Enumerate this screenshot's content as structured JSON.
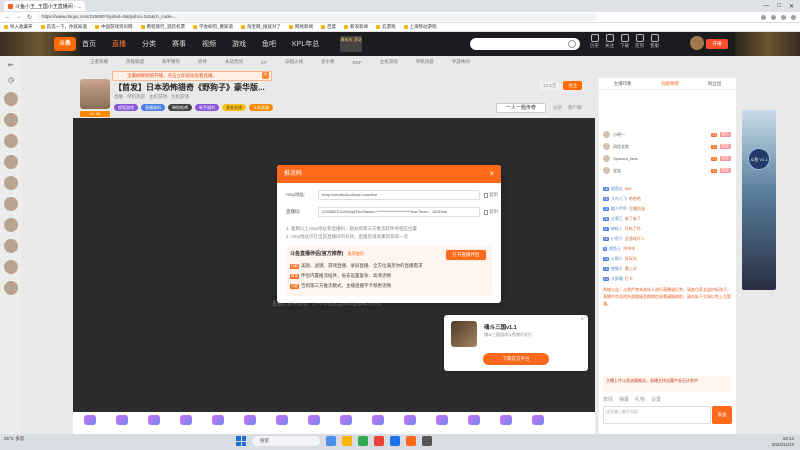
{
  "browser": {
    "tabs": [
      "斗鱼小王_王国小王直播间 - ..."
    ],
    "url": "https://www.douyu.com/226580?dyshid=0&dyshci=181&ch_code=...",
    "bookmarks": [
      "导入收藏夹",
      "首选一下，你就知道",
      "中国游戏资讯网",
      "携程旅行_酒店机票",
      "学会如何_要知道",
      "淘宝网_搜就对了",
      "网易新闻",
      "百度",
      "新浪新闻",
      "云游戏",
      "上海移动游戏"
    ]
  },
  "header": {
    "logo": "斗鱼",
    "nav": [
      "首页",
      "直播",
      "分类",
      "赛事",
      "视频",
      "游戏",
      "鱼吧",
      "KPL年总"
    ],
    "promo": "周年庆 活动",
    "icons": [
      "历史",
      "关注",
      "下载",
      "签到",
      "客服"
    ],
    "live_button": "开播"
  },
  "subnav": [
    "王者荣耀",
    "英雄联盟",
    "和平精英",
    "原神",
    "永劫无间",
    "CF",
    "穿越火线",
    "逆水寒",
    "DNF",
    "主机游戏",
    "单机热游",
    "手游休闲"
  ],
  "sidebar": {
    "icons": [
      "collapse-icon",
      "history-icon",
      "follow-icon"
    ]
  },
  "streamer": {
    "notification": "宝藏蝴蝶刚刚开播，点击立即前往观看直播。",
    "title": "【首发】日本恐怖猎奇《野狗子》豪华版...",
    "meta": "直播 · 单机热游 · 主机游戏 · 主机游戏",
    "level": "LV 45",
    "tags": [
      "超强游戏",
      "直播福利",
      "带你吃鸡",
      "新手福利",
      "美食直播",
      "斗鱼直播"
    ],
    "follow_count": "13.3万",
    "follow_label": "关注",
    "phone_live": "一人一题传奇",
    "share": [
      "分享",
      "客户端"
    ]
  },
  "player": {
    "hint": "主播已暂停直播，您可以在这里获取直播推流地址"
  },
  "modal": {
    "title": "推流码",
    "fields": [
      {
        "label": "rtmp地址:",
        "value": "rtmp://sendtc3a.douyu.com/live",
        "copy": "复制"
      },
      {
        "label": "直播码:",
        "value": "226580rDGvNGqAFbxSiaiam=**********************&acTime=...&DIDsis",
        "copy": "复制"
      }
    ],
    "steps": [
      "1. 复制以上rtmp地址和直播码，粘贴到第三方推流软件的相应位置",
      "2. rtmp地址仅在当前直播间内有效，直播后请再重新获取一次"
    ],
    "promo_title": "斗鱼直播伴侣(官方推荐)",
    "promo_sub": "推荐使用",
    "promo_button": "打开直播伴侣",
    "promo_lines": [
      {
        "badge": "功能",
        "text": "美颜、滤镜、游戏直播、录屏直播、全方位满足你的直播需求"
      },
      {
        "badge": "简单",
        "text": "伴侣内置推流插件，省去设置复杂、高清流畅"
      },
      {
        "badge": "功能",
        "text": "告别第三方推流模式，主播直播不卡顿更流畅"
      }
    ]
  },
  "download_card": {
    "title": "魂斗三国v1.1",
    "subtitle": "魂斗三国游戏斗鱼独代发行",
    "button": "下载官方平台"
  },
  "right_panel": {
    "tabs": [
      "主播印象",
      "贡献周榜",
      "粉丝团"
    ],
    "contributors": [
      {
        "name": "小明一",
        "level": "25",
        "badge": "鱼丸"
      },
      {
        "name": "风往北吹",
        "level": "22",
        "badge": "粉丝"
      },
      {
        "name": "Sponsor_fans",
        "level": "21",
        "badge": "粉丝"
      },
      {
        "name": "宝宝",
        "level": "20",
        "badge": "粉丝"
      }
    ],
    "chat": [
      {
        "level": "18",
        "user": "银鱼丸",
        "msg": "666"
      },
      {
        "level": "15",
        "user": "大鸟儿飞",
        "msg": "哈哈哈"
      },
      {
        "level": "12",
        "user": "路人甲甲",
        "msg": "主播加油"
      },
      {
        "level": "20",
        "user": "过客乙",
        "msg": "来了来了"
      },
      {
        "level": "11",
        "user": "神秘人",
        "msg": "开始了吗"
      },
      {
        "level": "16",
        "user": "小鱼干",
        "msg": "这游戏吓人"
      },
      {
        "level": "9",
        "user": "咸鱼王",
        "msg": "冲冲冲"
      },
      {
        "level": "13",
        "user": "火锅人",
        "msg": "好玩吗"
      },
      {
        "level": "19",
        "user": "夜猫子",
        "msg": "晚上好"
      },
      {
        "level": "14",
        "user": "大胖橘",
        "msg": "打卡"
      }
    ],
    "notice": "系统公告：斗鱼严禁未成年人进行直播或打赏，请各位家长监护好孩子。直播中涉及的外部链接及购物信息需谨慎辨别，请勿私下交易以免上当受骗。",
    "broadcast": "主播上传斗鱼流量推送，直播主持宝藏中金石计划中",
    "toolbar": [
      "表情",
      "弹幕",
      "礼物",
      "设置"
    ],
    "input_placeholder": "这里输入聊天内容",
    "send": "发送"
  },
  "right_ad": {
    "badge": "斗鱼 V1.1"
  },
  "taskbar": {
    "weather": "26°C 多云",
    "search": "搜索",
    "time": "19:12",
    "date": "2024/11/23"
  }
}
